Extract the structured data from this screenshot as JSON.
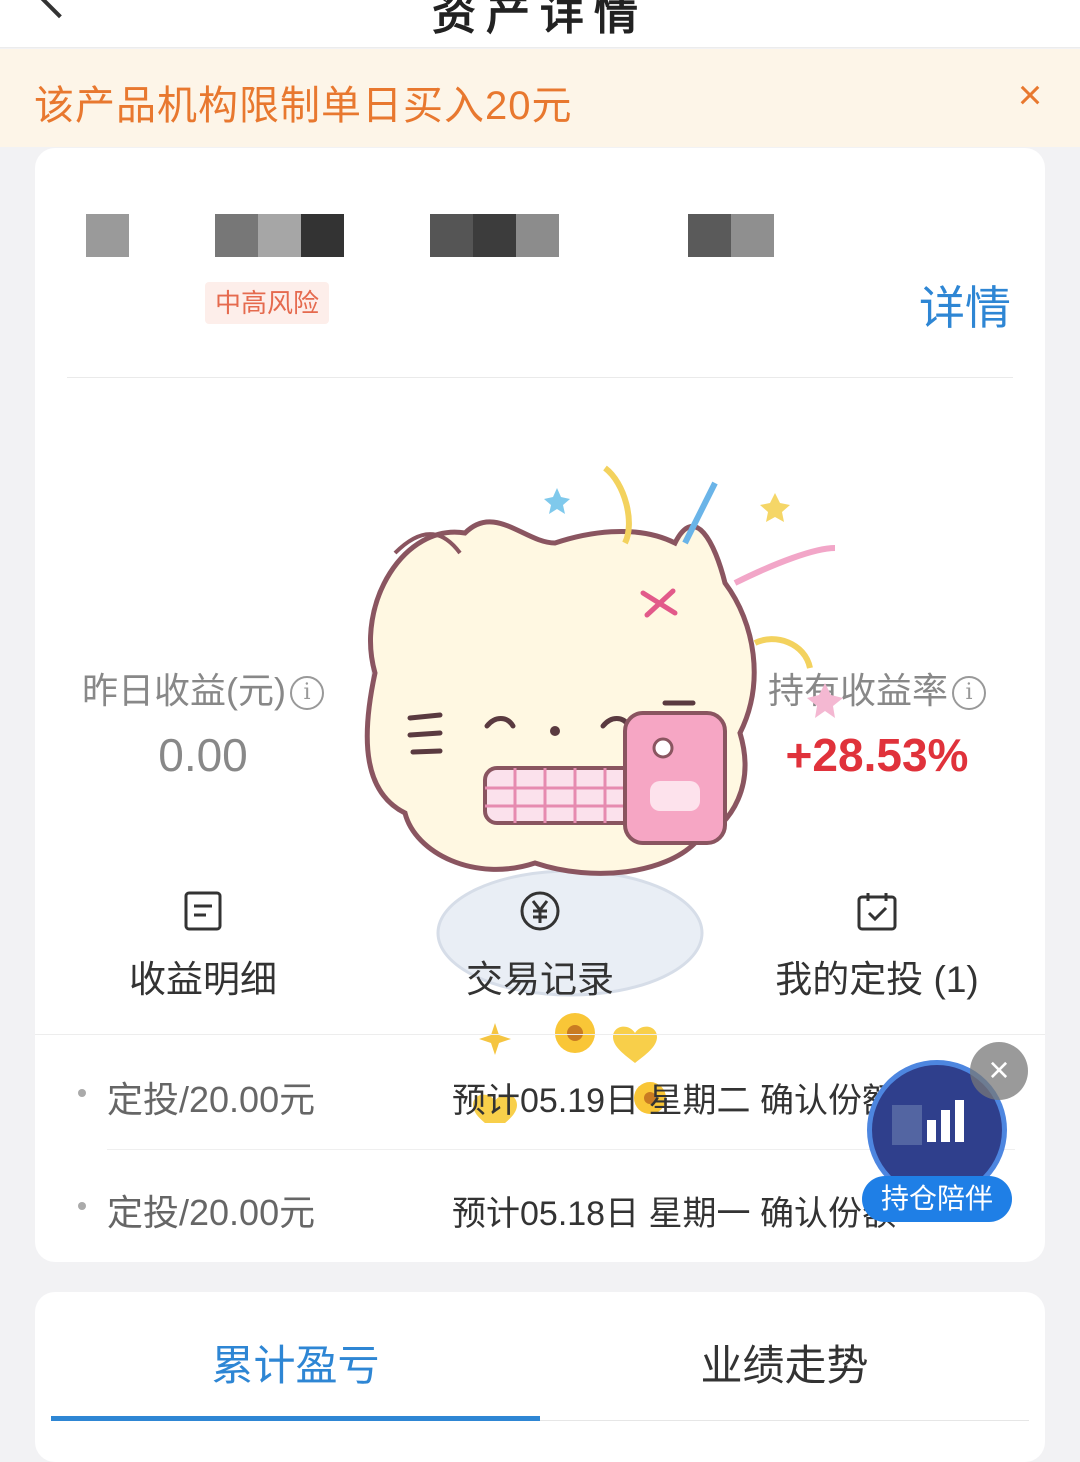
{
  "header": {
    "title": "资产详情"
  },
  "notice": {
    "text": "该产品机构限制单日买入20元",
    "close_icon": "close-icon"
  },
  "product": {
    "risk_tag": "中高风险",
    "detail_link": "详情"
  },
  "stats": {
    "yesterday": {
      "label": "昨日收益(元)",
      "value": "0.00",
      "info_icon": "info-icon"
    },
    "holding_rate": {
      "label": "持有收益率",
      "value": "+28.53%",
      "info_icon": "info-icon",
      "color": "#e0323b"
    }
  },
  "actions": [
    {
      "label": "收益明细",
      "icon": "document-icon"
    },
    {
      "label": "交易记录",
      "icon": "yuan-coin-icon"
    },
    {
      "label": "我的定投 (1)",
      "icon": "calendar-check-icon"
    }
  ],
  "plans": [
    {
      "name": "定投/20.00元",
      "desc": "预计05.19日 星期二 确认份额"
    },
    {
      "name": "定投/20.00元",
      "desc": "预计05.18日 星期一 确认份额"
    }
  ],
  "floating": {
    "label": "持仓陪伴",
    "icon": "chart-bars-icon",
    "close_icon": "close-icon"
  },
  "tabs": [
    {
      "label": "累计盈亏",
      "active": true
    },
    {
      "label": "业绩走势",
      "active": false
    }
  ],
  "colors": {
    "accent": "#2e86d4",
    "warning": "#e8782f",
    "positive": "#e0323b"
  }
}
